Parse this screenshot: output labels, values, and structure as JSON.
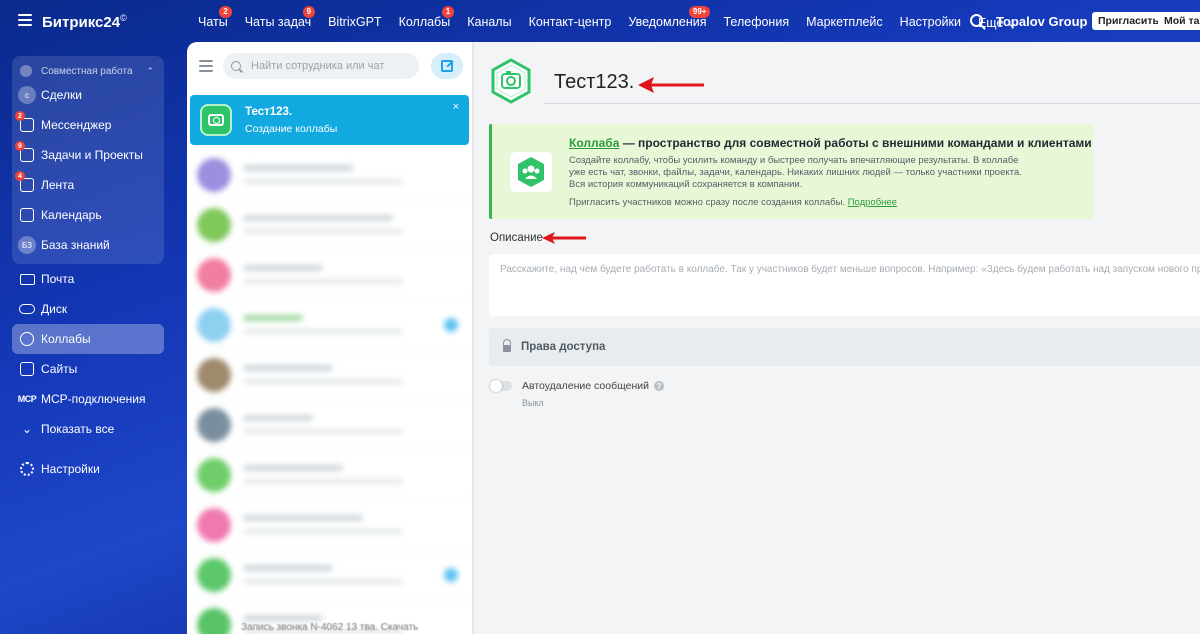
{
  "app": {
    "logo": "Битрикс24",
    "logo_mark": "©",
    "company": "Topalov Group",
    "invite_label": "Пригласить",
    "tariff_label": "Мой тариф"
  },
  "topnav": [
    {
      "label": "Чаты",
      "badge": "2"
    },
    {
      "label": "Чаты задач",
      "badge": "9"
    },
    {
      "label": "BitrixGPT",
      "badge": ""
    },
    {
      "label": "Коллабы",
      "badge": "1"
    },
    {
      "label": "Каналы",
      "badge": ""
    },
    {
      "label": "Контакт-центр",
      "badge": ""
    },
    {
      "label": "Уведомления",
      "badge": "99+"
    },
    {
      "label": "Телефония",
      "badge": ""
    },
    {
      "label": "Маркетплейс",
      "badge": ""
    },
    {
      "label": "Настройки",
      "badge": ""
    },
    {
      "label": "Еще ⌄",
      "badge": ""
    }
  ],
  "sidebar": {
    "group_title": "Совместная работа",
    "group_items": [
      {
        "label": "Сделки",
        "icon": "deals-icon",
        "glyph": "c",
        "badge": ""
      },
      {
        "label": "Мессенджер",
        "icon": "messenger-icon",
        "glyph": "",
        "badge": "2"
      },
      {
        "label": "Задачи и Проекты",
        "icon": "tasks-icon",
        "glyph": "",
        "badge": "9"
      },
      {
        "label": "Лента",
        "icon": "feed-icon",
        "glyph": "",
        "badge": "4"
      },
      {
        "label": "Календарь",
        "icon": "calendar-icon",
        "glyph": "",
        "badge": ""
      },
      {
        "label": "База знаний",
        "icon": "knowledge-base-icon",
        "glyph": "БЗ",
        "badge": ""
      }
    ],
    "items": [
      {
        "label": "Почта",
        "icon": "mail-icon"
      },
      {
        "label": "Диск",
        "icon": "disk-icon"
      },
      {
        "label": "Коллабы",
        "icon": "collabs-icon",
        "active": true
      },
      {
        "label": "Сайты",
        "icon": "sites-icon"
      },
      {
        "label": "MCP-подключения",
        "icon": "mcp-icon",
        "glyph": "MCP"
      },
      {
        "label": "Показать все",
        "icon": "chevron-down-icon"
      }
    ],
    "settings_label": "Настройки"
  },
  "chatlist": {
    "search_placeholder": "Найти сотрудника или чат",
    "active_chat": {
      "title": "Тест123.",
      "subtitle": "Создание коллабы",
      "close": "×"
    },
    "last_row_text": "Запись звонка N-4062 13 тва. Скачать"
  },
  "main": {
    "title": "Тест123.",
    "info": {
      "link": "Коллаба",
      "title_rest": " — пространство для совместной работы с внешними командами и клиентами",
      "text": "Создайте коллабу, чтобы усилить команду и быстрее получать впечатляющие результаты. В коллабе уже есть чат, звонки, файлы, задачи, календарь. Никаких лишних людей — только участники проекта. Вся история коммуникаций сохраняется в компании.",
      "text2": "Пригласить участников можно сразу после создания коллабы.",
      "more": "Подробнее"
    },
    "description_label": "Описание",
    "description_placeholder": "Расскажите, над чем будете работать в коллабе. Так у участников будет меньше вопросов. Например: «Здесь будем работать над запуском нового продукта»",
    "access_label": "Права доступа",
    "autodelete_label": "Автоудаление сообщений",
    "autodelete_help": "?",
    "autodelete_state": "Выкл"
  },
  "colors": {
    "accent_blue": "#11a9e0",
    "collab_green": "#2fc46a",
    "arrow_red": "#e0161d",
    "info_bg": "#e8f7d6"
  }
}
